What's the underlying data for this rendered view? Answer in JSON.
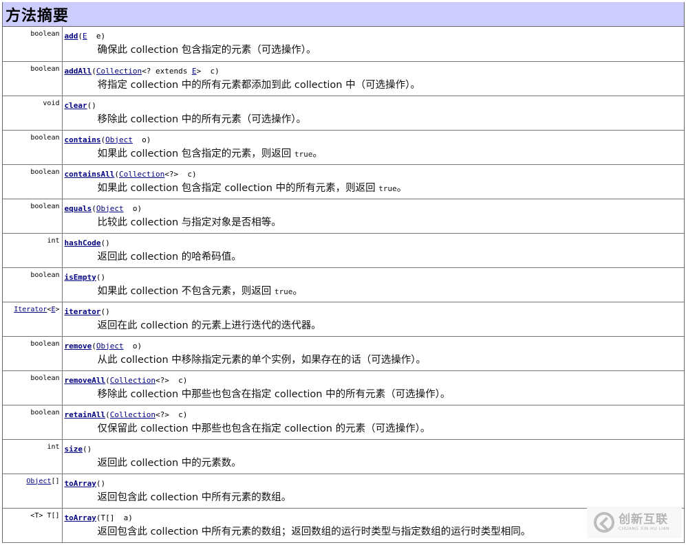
{
  "section_title": "方法摘要",
  "methods": [
    {
      "ret": "boolean",
      "name": "add",
      "params": [
        {
          "t": "text",
          "v": "("
        },
        {
          "t": "link",
          "v": "E"
        },
        {
          "t": "text",
          "v": "  e)"
        }
      ],
      "desc": [
        {
          "t": "text",
          "v": "确保此 collection 包含指定的元素（可选操作）。"
        }
      ]
    },
    {
      "ret": "boolean",
      "name": "addAll",
      "params": [
        {
          "t": "text",
          "v": "("
        },
        {
          "t": "link",
          "v": "Collection"
        },
        {
          "t": "text",
          "v": "<? extends "
        },
        {
          "t": "link",
          "v": "E"
        },
        {
          "t": "text",
          "v": ">  c)"
        }
      ],
      "desc": [
        {
          "t": "text",
          "v": "将指定 collection 中的所有元素都添加到此 collection 中（可选操作）。"
        }
      ]
    },
    {
      "ret": "void",
      "name": "clear",
      "params": [
        {
          "t": "text",
          "v": "()"
        }
      ],
      "desc": [
        {
          "t": "text",
          "v": "移除此 collection 中的所有元素（可选操作）。"
        }
      ]
    },
    {
      "ret": "boolean",
      "name": "contains",
      "params": [
        {
          "t": "text",
          "v": "("
        },
        {
          "t": "link",
          "v": "Object"
        },
        {
          "t": "text",
          "v": "  o)"
        }
      ],
      "desc": [
        {
          "t": "text",
          "v": "如果此 collection 包含指定的元素，则返回 "
        },
        {
          "t": "mono",
          "v": "true"
        },
        {
          "t": "text",
          "v": "。"
        }
      ]
    },
    {
      "ret": "boolean",
      "name": "containsAll",
      "params": [
        {
          "t": "text",
          "v": "("
        },
        {
          "t": "link",
          "v": "Collection"
        },
        {
          "t": "text",
          "v": "<?>  c)"
        }
      ],
      "desc": [
        {
          "t": "text",
          "v": "如果此 collection 包含指定 collection 中的所有元素，则返回 "
        },
        {
          "t": "mono",
          "v": "true"
        },
        {
          "t": "text",
          "v": "。"
        }
      ]
    },
    {
      "ret": "boolean",
      "name": "equals",
      "params": [
        {
          "t": "text",
          "v": "("
        },
        {
          "t": "link",
          "v": "Object"
        },
        {
          "t": "text",
          "v": "  o)"
        }
      ],
      "desc": [
        {
          "t": "text",
          "v": "比较此 collection 与指定对象是否相等。"
        }
      ]
    },
    {
      "ret": "int",
      "name": "hashCode",
      "params": [
        {
          "t": "text",
          "v": "()"
        }
      ],
      "desc": [
        {
          "t": "text",
          "v": "返回此 collection 的哈希码值。"
        }
      ]
    },
    {
      "ret": "boolean",
      "name": "isEmpty",
      "params": [
        {
          "t": "text",
          "v": "()"
        }
      ],
      "desc": [
        {
          "t": "text",
          "v": "如果此 collection 不包含元素，则返回 "
        },
        {
          "t": "mono",
          "v": "true"
        },
        {
          "t": "text",
          "v": "。"
        }
      ]
    },
    {
      "ret_link": "Iterator",
      "ret_mid": "<",
      "ret_link2": "E",
      "ret_end": ">",
      "name": "iterator",
      "params": [
        {
          "t": "text",
          "v": "()"
        }
      ],
      "desc": [
        {
          "t": "text",
          "v": "返回在此 collection 的元素上进行迭代的迭代器。"
        }
      ]
    },
    {
      "ret": "boolean",
      "name": "remove",
      "params": [
        {
          "t": "text",
          "v": "("
        },
        {
          "t": "link",
          "v": "Object"
        },
        {
          "t": "text",
          "v": "  o)"
        }
      ],
      "desc": [
        {
          "t": "text",
          "v": "从此 collection 中移除指定元素的单个实例，如果存在的话（可选操作）。"
        }
      ]
    },
    {
      "ret": "boolean",
      "name": "removeAll",
      "params": [
        {
          "t": "text",
          "v": "("
        },
        {
          "t": "link",
          "v": "Collection"
        },
        {
          "t": "text",
          "v": "<?>  c)"
        }
      ],
      "desc": [
        {
          "t": "text",
          "v": "移除此 collection 中那些也包含在指定 collection 中的所有元素（可选操作）。"
        }
      ]
    },
    {
      "ret": "boolean",
      "name": "retainAll",
      "params": [
        {
          "t": "text",
          "v": "("
        },
        {
          "t": "link",
          "v": "Collection"
        },
        {
          "t": "text",
          "v": "<?>  c)"
        }
      ],
      "desc": [
        {
          "t": "text",
          "v": "仅保留此 collection 中那些也包含在指定 collection 的元素（可选操作）。"
        }
      ]
    },
    {
      "ret": "int",
      "name": "size",
      "params": [
        {
          "t": "text",
          "v": "()"
        }
      ],
      "desc": [
        {
          "t": "text",
          "v": "返回此 collection 中的元素数。"
        }
      ]
    },
    {
      "ret_link": "Object",
      "ret_end": "[]",
      "name": "toArray",
      "params": [
        {
          "t": "text",
          "v": "()"
        }
      ],
      "desc": [
        {
          "t": "text",
          "v": "返回包含此 collection 中所有元素的数组。"
        }
      ]
    },
    {
      "ret": "<T> T[]",
      "name": "toArray",
      "params": [
        {
          "t": "text",
          "v": "(T[]  a)"
        }
      ],
      "desc": [
        {
          "t": "text",
          "v": "返回包含此 collection 中所有元素的数组；返回数组的运行时类型与指定数组的运行时类型相同。"
        }
      ]
    }
  ],
  "watermark": {
    "cn": "创新互联",
    "en": "CHUANG XIN HU LIAN"
  },
  "colors": {
    "header_bg": "#ccccff",
    "link": "#000080",
    "border": "#777777"
  }
}
